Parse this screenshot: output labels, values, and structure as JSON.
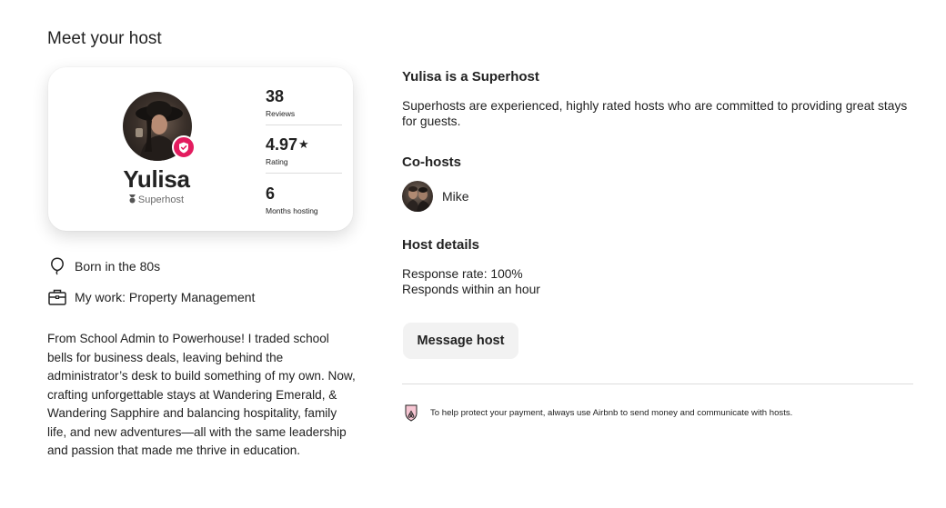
{
  "section": {
    "title": "Meet your host"
  },
  "host_card": {
    "name": "Yulisa",
    "role": "Superhost",
    "stats": [
      {
        "value": "38",
        "label": "Reviews"
      },
      {
        "value": "4.97",
        "label": "Rating",
        "icon": "star-icon"
      },
      {
        "value": "6",
        "label": "Months hosting"
      }
    ]
  },
  "facts": [
    {
      "icon": "balloon-icon",
      "text": "Born in the 80s"
    },
    {
      "icon": "briefcase-icon",
      "text": "My work: Property Management"
    }
  ],
  "bio": "From School Admin to Powerhouse! I traded school bells for business deals, leaving behind the administrator’s desk to build something of my own. Now, crafting unforgettable stays at Wandering Emerald, & Wandering Sapphire and balancing hospitality, family life, and new adventures—all with the same leadership and passion that made me thrive in education.",
  "superhost": {
    "heading": "Yulisa is a Superhost",
    "description": "Superhosts are experienced, highly rated hosts who are committed to providing great stays for guests."
  },
  "cohosts": {
    "heading": "Co-hosts",
    "items": [
      {
        "name": "Mike"
      }
    ]
  },
  "host_details": {
    "heading": "Host details",
    "response_rate": "Response rate: 100%",
    "response_time": "Responds within an hour"
  },
  "message_button": {
    "label": "Message host"
  },
  "payment_notice": {
    "text": "To help protect your payment, always use Airbnb to send money and communicate with hosts."
  },
  "colors": {
    "accent": "#e31c5f",
    "text": "#222222",
    "muted": "#6a6a6a",
    "button_bg": "#f2f2f2",
    "divider": "#dddddd"
  }
}
